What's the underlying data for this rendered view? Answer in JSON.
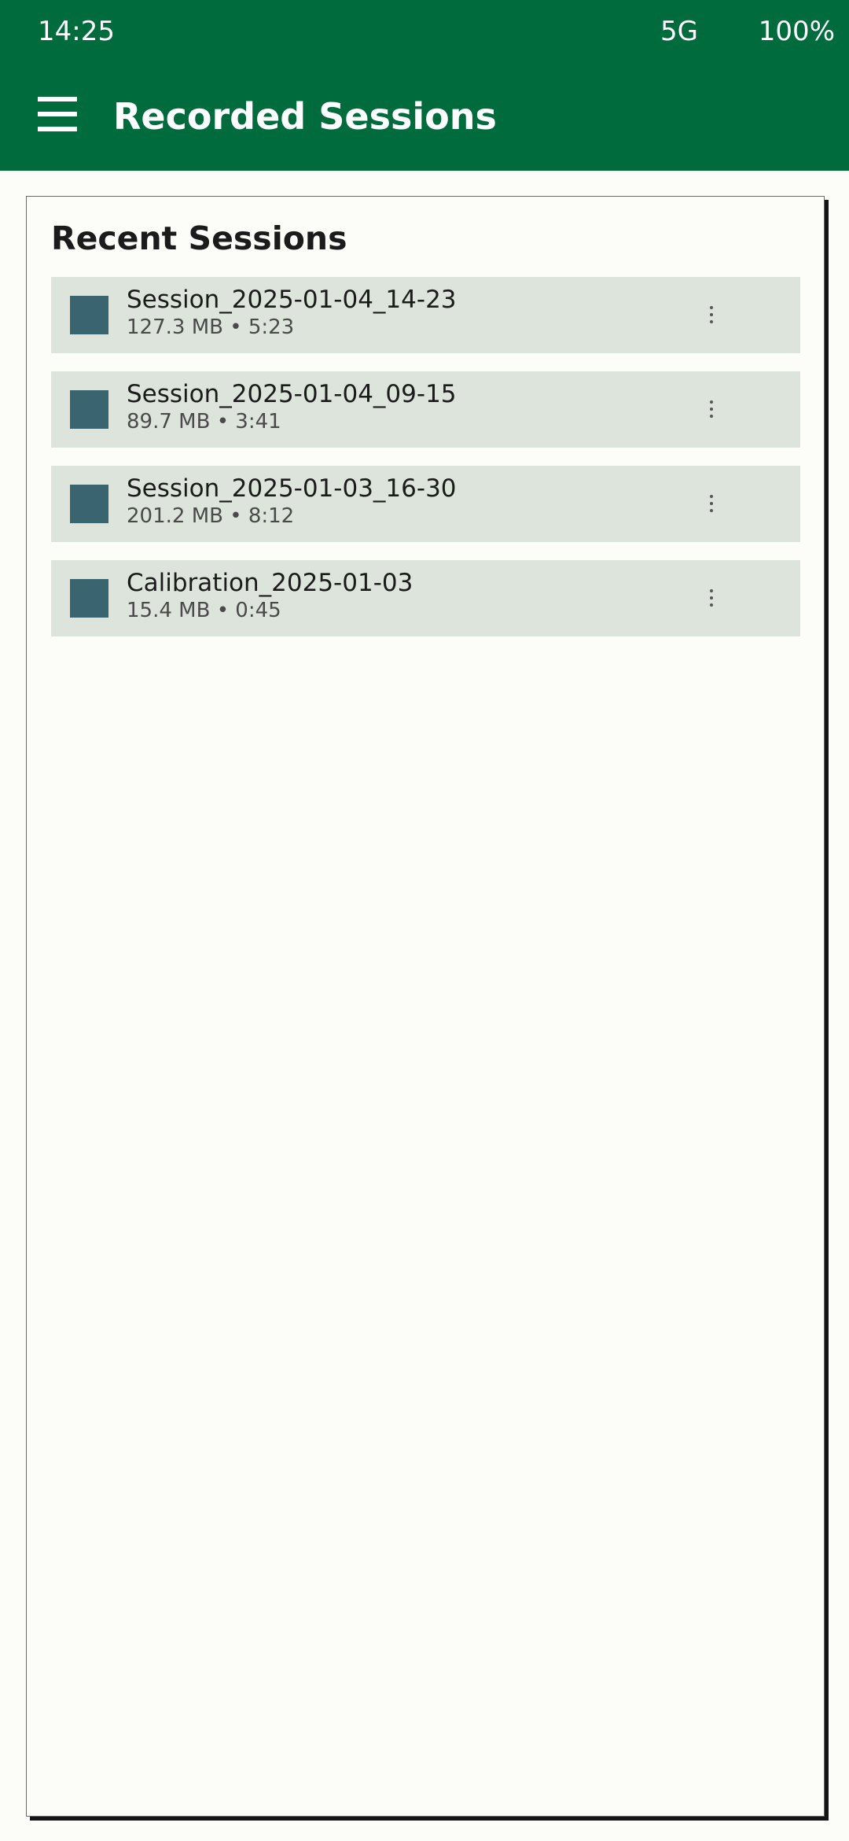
{
  "status_bar": {
    "time": "14:25",
    "network": "5G",
    "battery": "100%"
  },
  "app_bar": {
    "menu_icon": "hamburger-menu-icon",
    "title": "Recorded Sessions"
  },
  "card": {
    "title": "Recent Sessions",
    "items": [
      {
        "name": "Session_2025-01-04_14-23",
        "meta": "127.3 MB • 5:23"
      },
      {
        "name": "Session_2025-01-04_09-15",
        "meta": "89.7 MB • 3:41"
      },
      {
        "name": "Session_2025-01-03_16-30",
        "meta": "201.2 MB • 8:12"
      },
      {
        "name": "Calibration_2025-01-03",
        "meta": "15.4 MB • 0:45"
      }
    ]
  },
  "colors": {
    "primary": "#006b3c",
    "background": "#fcfdf9",
    "list_item": "#dde4dc",
    "thumbnail": "#3a6470"
  }
}
